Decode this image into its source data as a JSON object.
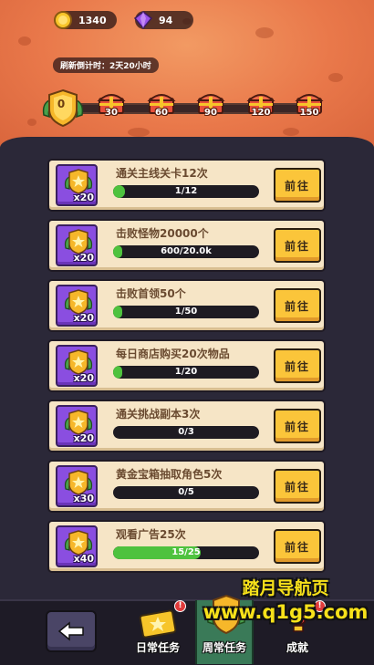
{
  "resources": {
    "gold": "1340",
    "gems": "94"
  },
  "refresh_label": "刷新倒计时：2天20小时",
  "progress": {
    "current_points": "0",
    "milestones": [
      "30",
      "60",
      "90",
      "120",
      "150"
    ]
  },
  "tasks": [
    {
      "title": "通关主线关卡12次",
      "reward_qty": "x20",
      "progress_text": "1/12",
      "fraction": 0.0833,
      "button": "前往"
    },
    {
      "title": "击败怪物20000个",
      "reward_qty": "x20",
      "progress_text": "600/20.0k",
      "fraction": 0.03,
      "button": "前往"
    },
    {
      "title": "击败首领50个",
      "reward_qty": "x20",
      "progress_text": "1/50",
      "fraction": 0.02,
      "button": "前往"
    },
    {
      "title": "每日商店购买20次物品",
      "reward_qty": "x20",
      "progress_text": "1/20",
      "fraction": 0.05,
      "button": "前往"
    },
    {
      "title": "通关挑战副本3次",
      "reward_qty": "x20",
      "progress_text": "0/3",
      "fraction": 0,
      "button": "前往"
    },
    {
      "title": "黄金宝箱抽取角色5次",
      "reward_qty": "x30",
      "progress_text": "0/5",
      "fraction": 0,
      "button": "前往"
    },
    {
      "title": "观看广告25次",
      "reward_qty": "x40",
      "progress_text": "15/25",
      "fraction": 0.6,
      "button": "前往"
    }
  ],
  "nav": {
    "daily": "日常任务",
    "weekly": "周常任务",
    "achievements": "成就",
    "notif": "!"
  },
  "watermark": {
    "line1": "踏月导航页",
    "line2": "www.q1g5.com"
  },
  "colors": {
    "accent_orange": "#e9784a",
    "button_yellow": "#fbc53a",
    "progress_green": "#4ec23e",
    "badge_purple": "#8a4ee0"
  }
}
